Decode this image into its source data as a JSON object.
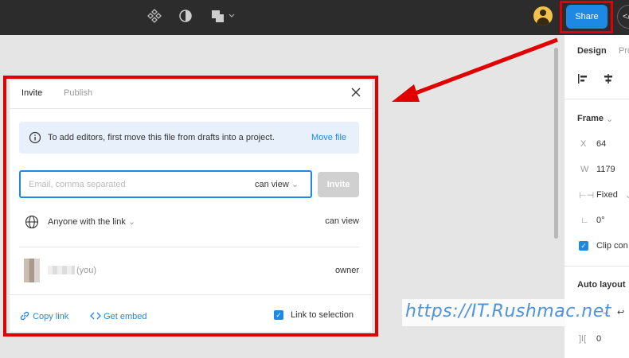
{
  "toolbar": {
    "share_label": "Share",
    "code_label": "</",
    "icons": [
      "components-icon",
      "contrast-icon",
      "boolean-icon",
      "avatar-icon",
      "code-icon"
    ]
  },
  "design_panel": {
    "tab_design": "Design",
    "tab_prototype": "Pro",
    "frame_label": "Frame",
    "x_label": "X",
    "x_value": "64",
    "w_label": "W",
    "w_value": "1179",
    "constraint": "Fixed",
    "rotation_label": "∟",
    "rotation_value": "0°",
    "clip_label": "Clip con",
    "clip_checked": true,
    "auto_layout_label": "Auto layout",
    "spacing_label": "]I[",
    "spacing_value": "0"
  },
  "dialog": {
    "tab_invite": "Invite",
    "tab_publish": "Publish",
    "info_text": "To add editors, first move this file from drafts into a project.",
    "move_file_label": "Move file",
    "email_placeholder": "Email, comma separated",
    "email_permission": "can view",
    "invite_label": "Invite",
    "link_access": "Anyone with the link",
    "link_permission": "can view",
    "member_you": "(you)",
    "member_role": "owner",
    "copy_link_label": "Copy link",
    "get_embed_label": "Get embed",
    "link_to_selection_label": "Link to selection",
    "link_to_selection_checked": true
  },
  "watermark": "https://IT.Rushmac.net",
  "colors": {
    "accent": "#1e88e5",
    "highlight": "#e00000",
    "toolbar_bg": "#2c2c2c",
    "canvas_bg": "#e5e5e5"
  }
}
